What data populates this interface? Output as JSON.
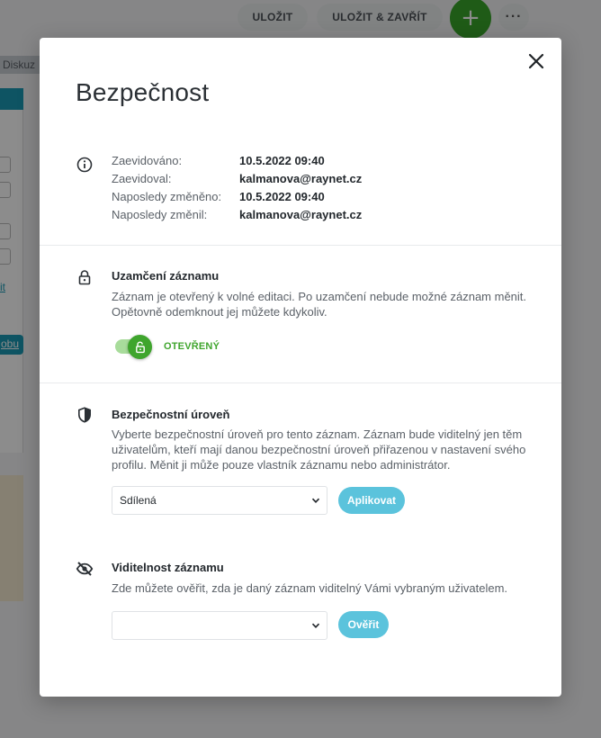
{
  "background": {
    "save_label": "ULOŽIT",
    "save_close_label": "ULOŽIT & ZAVŘÍT",
    "add_label": "+",
    "more_label": "···",
    "tab_label": "Diskuz",
    "link_label": "it",
    "pill_label": "obu"
  },
  "modal": {
    "title": "Bezpečnost",
    "audit": {
      "rows": [
        {
          "label": "Zaevidováno:",
          "value": "10.5.2022 09:40"
        },
        {
          "label": "Zaevidoval:",
          "value": "kalmanova@raynet.cz"
        },
        {
          "label": "Naposledy změněno:",
          "value": "10.5.2022 09:40"
        },
        {
          "label": "Naposledy změnil:",
          "value": "kalmanova@raynet.cz"
        }
      ]
    },
    "lock": {
      "title": "Uzamčení záznamu",
      "description": "Záznam je otevřený k volné editaci. Po uzamčení nebude možné záznam měnit. Opětovně odemknout jej můžete kdykoliv.",
      "state_label": "OTEVŘENÝ"
    },
    "security_level": {
      "title": "Bezpečnostní úroveň",
      "description": "Vyberte bezpečnostní úroveň pro tento záznam. Záznam bude viditelný jen těm uživatelům, kteří mají danou bezpečnostní úroveň přiřazenou v nastavení svého profilu. Měnit ji může pouze vlastník záznamu nebo administrátor.",
      "selected": "Sdílená",
      "apply_label": "Aplikovat"
    },
    "visibility": {
      "title": "Viditelnost záznamu",
      "description": "Zde můžete ověřit, zda je daný záznam viditelný Vámi vybraným uživatelem.",
      "selected": "",
      "verify_label": "Ověřit"
    }
  },
  "colors": {
    "accent_green": "#3fa52d",
    "accent_blue": "#5bc3dc",
    "fab_green": "#3aa62a"
  }
}
